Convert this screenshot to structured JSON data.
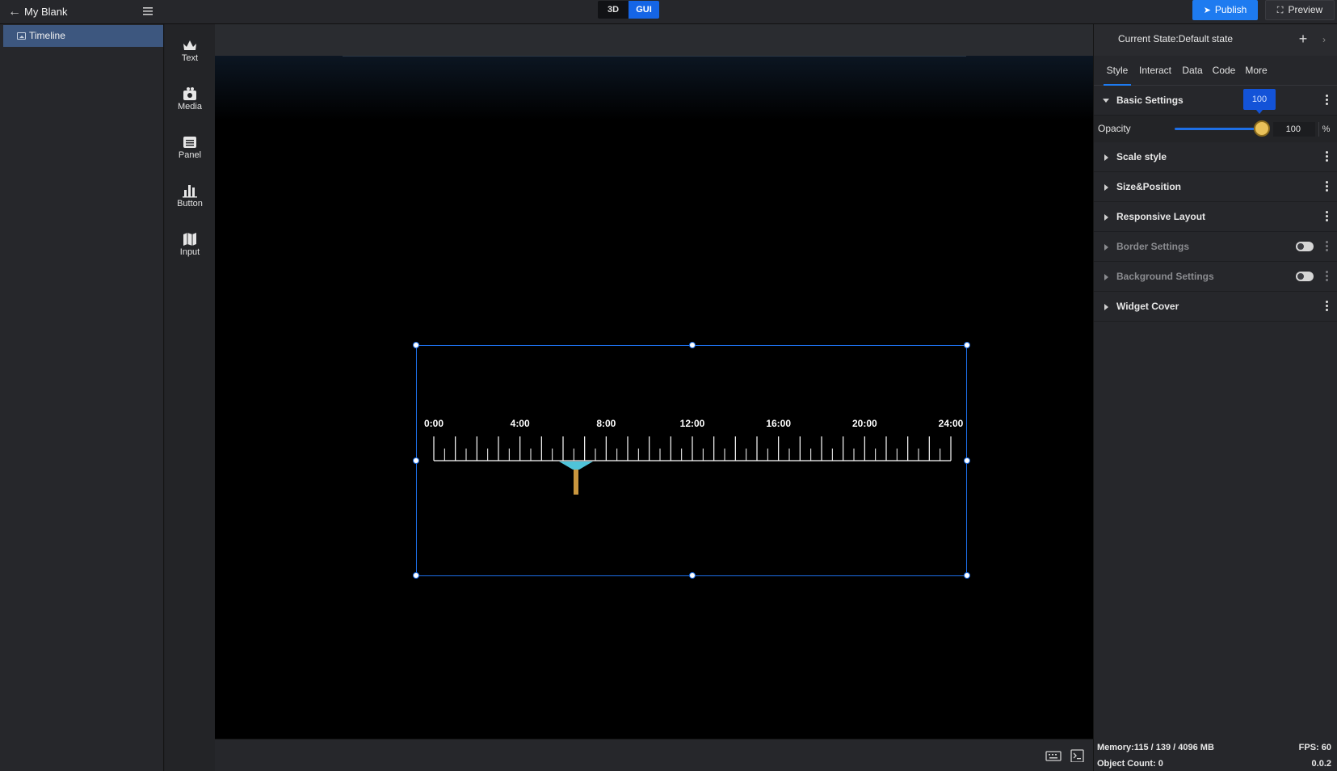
{
  "topbar": {
    "project_name": "My Blank",
    "modes": [
      {
        "label": "3D",
        "active": false
      },
      {
        "label": "GUI",
        "active": true
      }
    ],
    "publish_label": "Publish",
    "preview_label": "Preview"
  },
  "layers": [
    {
      "label": "Timeline",
      "icon": "image-icon",
      "selected": true
    }
  ],
  "widgets": [
    {
      "label": "Text",
      "icon": "text-icon"
    },
    {
      "label": "Media",
      "icon": "media-icon"
    },
    {
      "label": "Panel",
      "icon": "panel-icon"
    },
    {
      "label": "Button",
      "icon": "button-icon"
    },
    {
      "label": "Input",
      "icon": "input-icon"
    }
  ],
  "timeline": {
    "labels": [
      "0:00",
      "4:00",
      "8:00",
      "12:00",
      "16:00",
      "20:00",
      "24:00"
    ],
    "major_ticks": 24,
    "minor_per_major": 1,
    "pointer_value_hours": 6.6,
    "pointer_colors": {
      "cap": "#4fc3d9",
      "stem": "#c9963e"
    }
  },
  "panel": {
    "state_label": "Current State:Default state",
    "tabs": [
      {
        "label": "Style",
        "active": true
      },
      {
        "label": "Interact",
        "active": false
      },
      {
        "label": "Data",
        "active": false
      },
      {
        "label": "Code",
        "active": false
      },
      {
        "label": "More",
        "active": false
      }
    ],
    "basic_settings": "Basic Settings",
    "opacity": {
      "label": "Opacity",
      "value": "100",
      "unit": "%",
      "tooltip": "100",
      "level_percent": 100
    },
    "sections": [
      {
        "title": "Scale style",
        "enabled": true,
        "toggle": false
      },
      {
        "title": "Size&Position",
        "enabled": true,
        "toggle": false
      },
      {
        "title": "Responsive Layout",
        "enabled": true,
        "toggle": false
      },
      {
        "title": "Border Settings",
        "enabled": false,
        "toggle": true
      },
      {
        "title": "Background Settings",
        "enabled": false,
        "toggle": true
      },
      {
        "title": "Widget Cover",
        "enabled": true,
        "toggle": false
      }
    ],
    "footer": {
      "memory": "Memory:115 / 139 / 4096 MB",
      "fps": "FPS: 60",
      "object_count": "Object Count: 0",
      "version": "0.0.2"
    }
  },
  "colors": {
    "accent": "#1e7bf0",
    "selection": "#1d6fe8",
    "layer_selected": "#3d577f"
  }
}
